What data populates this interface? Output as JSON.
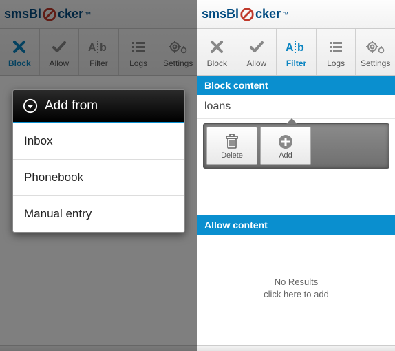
{
  "app": {
    "name_pre": "smsBl",
    "name_post": "cker",
    "tm": "™"
  },
  "toolbar": {
    "block": "Block",
    "allow": "Allow",
    "filter": "Filter",
    "logs": "Logs",
    "settings": "Settings"
  },
  "left": {
    "modal": {
      "title": "Add from",
      "items": [
        "Inbox",
        "Phonebook",
        "Manual entry"
      ]
    }
  },
  "right": {
    "block_header": "Block content",
    "block_entry": "loans",
    "actions": {
      "delete": "Delete",
      "add": "Add"
    },
    "allow_header": "Allow content",
    "no_results_line1": "No Results",
    "no_results_line2": "click here to add"
  }
}
